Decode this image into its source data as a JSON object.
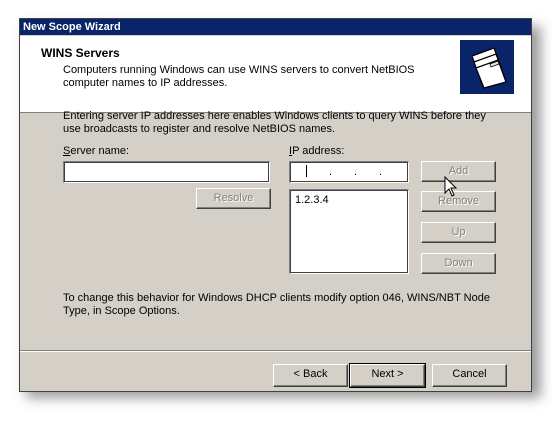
{
  "window": {
    "title": "New Scope Wizard"
  },
  "header": {
    "title": "WINS Servers",
    "subtitle": "Computers running Windows can use WINS servers to convert NetBIOS computer names to IP addresses.",
    "icon": "folders-icon"
  },
  "intro": "Entering server IP addresses here enables Windows clients to query WINS before they use broadcasts to register and resolve NetBIOS names.",
  "server_name": {
    "label": "Server name:",
    "value": ""
  },
  "ip_address": {
    "label": "IP address:",
    "value": ""
  },
  "ip_list": [
    "1.2.3.4"
  ],
  "buttons": {
    "resolve": "Resolve",
    "add": "Add",
    "remove": "Remove",
    "up": "Up",
    "down": "Down",
    "back": "< Back",
    "next": "Next >",
    "cancel": "Cancel"
  },
  "footer_text": "To change this behavior for Windows DHCP clients modify option 046, WINS/NBT Node Type, in Scope Options.",
  "colors": {
    "titlebar": "#0a246a",
    "dialog": "#d4d0c8"
  }
}
